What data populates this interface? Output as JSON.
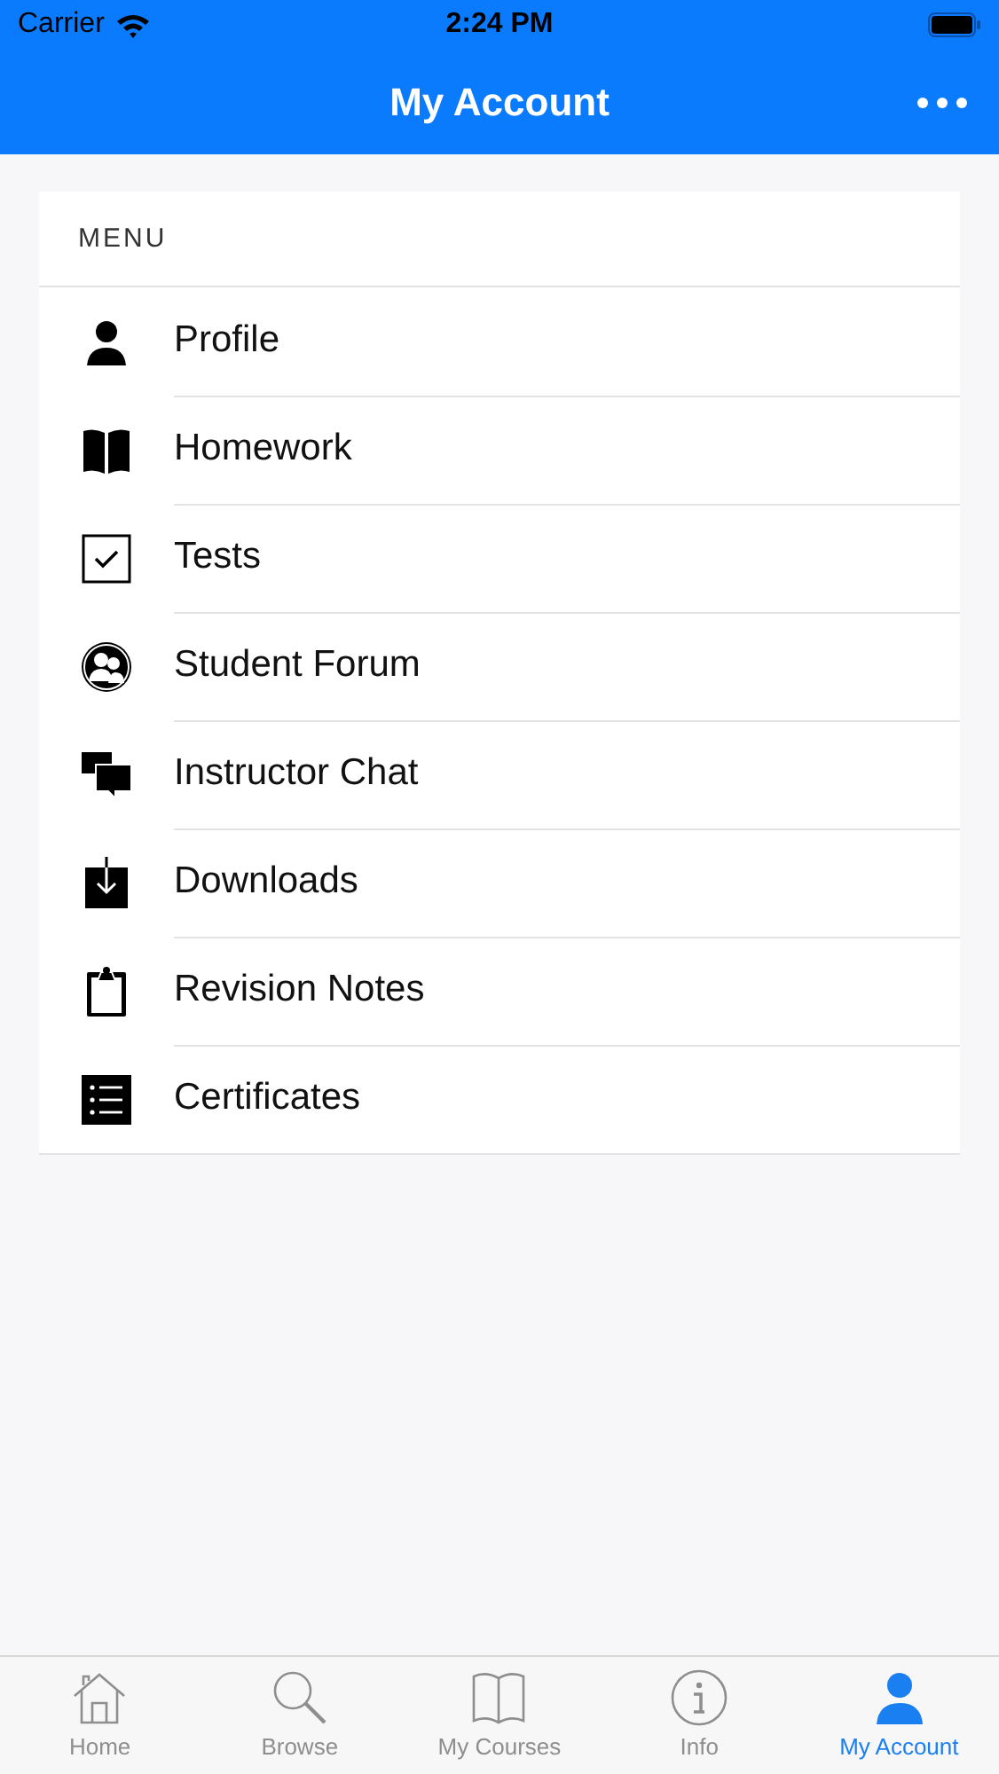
{
  "status_bar": {
    "carrier": "Carrier",
    "time": "2:24 PM"
  },
  "nav_bar": {
    "title": "My Account"
  },
  "menu": {
    "header": "MENU",
    "items": [
      {
        "label": "Profile",
        "kind": "person"
      },
      {
        "label": "Homework",
        "kind": "book"
      },
      {
        "label": "Tests",
        "kind": "check"
      },
      {
        "label": "Student Forum",
        "kind": "group"
      },
      {
        "label": "Instructor Chat",
        "kind": "chat"
      },
      {
        "label": "Downloads",
        "kind": "download"
      },
      {
        "label": "Revision Notes",
        "kind": "clipboard"
      },
      {
        "label": "Certificates",
        "kind": "list"
      }
    ]
  },
  "tab_bar": [
    {
      "label": "Home",
      "kind": "home",
      "selected": false
    },
    {
      "label": "Browse",
      "kind": "search",
      "selected": false
    },
    {
      "label": "My Courses",
      "kind": "book",
      "selected": false
    },
    {
      "label": "Info",
      "kind": "info",
      "selected": false
    },
    {
      "label": "My Account",
      "kind": "person",
      "selected": true
    }
  ]
}
